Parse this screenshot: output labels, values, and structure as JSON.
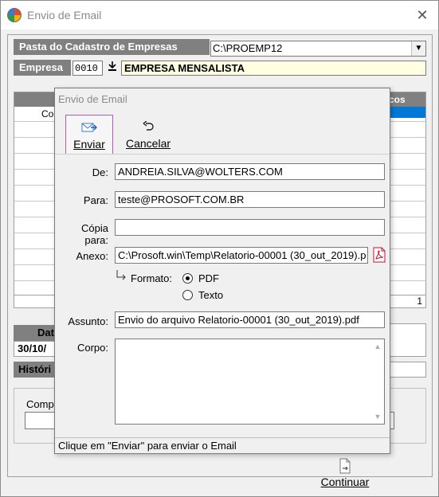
{
  "outer_window": {
    "title": "Envio de Email",
    "close_glyph": "✕",
    "app_icon": "app-logo-icon"
  },
  "company": {
    "folder_label": "Pasta do Cadastro de Empresas",
    "folder_value": "C:\\PROEMP12",
    "empresa_label": "Empresa",
    "empresa_code": "0010",
    "empresa_name": "EMPRESA MENSALISTA"
  },
  "background": {
    "grid_header_right": "cos",
    "grid_col_left": "Co",
    "grid_count": "1",
    "data_label": "Dat",
    "data_value": "30/10/",
    "historico_label": "Históri",
    "compe_label": "Compe"
  },
  "continuar": {
    "label": "Continuar",
    "icon": "document-arrow-icon"
  },
  "modal": {
    "title": "Envio de Email",
    "toolbar": {
      "enviar_label": "Enviar",
      "cancelar_label": "Cancelar"
    },
    "fields": {
      "de_label": "De:",
      "de_value": "ANDREIA.SILVA@WOLTERS.COM",
      "para_label": "Para:",
      "para_value": "teste@PROSOFT.COM.BR",
      "copia_label": "Cópia para:",
      "copia_value": "",
      "anexo_label": "Anexo:",
      "anexo_value": "C:\\Prosoft.win\\Temp\\Relatorio-00001 (30_out_2019).p",
      "formato_label": "Formato:",
      "formato_options": [
        "PDF",
        "Texto"
      ],
      "formato_selected": "PDF",
      "assunto_label": "Assunto:",
      "assunto_value": "Envio do arquivo Relatorio-00001 (30_out_2019).pdf",
      "corpo_label": "Corpo:",
      "corpo_value": ""
    },
    "status": "Clique em \"Enviar\" para enviar o Email"
  }
}
